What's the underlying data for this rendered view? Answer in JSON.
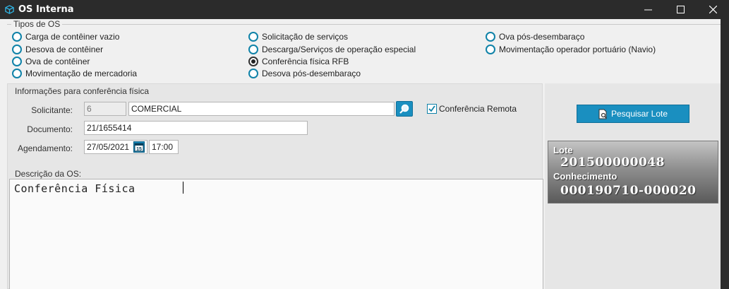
{
  "window": {
    "title": "OS Interna",
    "buttons": [
      "minimize",
      "maximize",
      "close"
    ]
  },
  "tipos_os": {
    "label": "Tipos de OS",
    "options": [
      {
        "label": "Carga de contêiner vazio",
        "selected": false
      },
      {
        "label": "Desova de contêiner",
        "selected": false
      },
      {
        "label": "Ova de contêiner",
        "selected": false
      },
      {
        "label": "Movimentação de mercadoria",
        "selected": false
      },
      {
        "label": "Solicitação de serviços",
        "selected": false
      },
      {
        "label": "Descarga/Serviços de operação especial",
        "selected": false
      },
      {
        "label": "Conferência física RFB",
        "selected": true
      },
      {
        "label": "Desova pós-desembaraço",
        "selected": false
      },
      {
        "label": "Ova pós-desembaraço",
        "selected": false
      },
      {
        "label": "Movimentação operador portuário (Navio)",
        "selected": false
      }
    ]
  },
  "info": {
    "title": "Informações para conferência física",
    "solicitante_label": "Solicitante:",
    "solicitante_code": "6",
    "solicitante_name": "COMERCIAL",
    "conferencia_remota_label": "Conferência Remota",
    "conferencia_remota_checked": true,
    "documento_label": "Documento:",
    "documento_value": "21/1655414",
    "agendamento_label": "Agendamento:",
    "agendamento_date": "27/05/2021",
    "agendamento_cal": "15",
    "agendamento_time": "17:00",
    "descricao_label": "Descrição da OS:",
    "descricao_value": "Conferência Física"
  },
  "right": {
    "pesquisar_lote_label": "Pesquisar Lote",
    "lote_caption": "Lote",
    "lote_value": "201500000048",
    "conhecimento_caption": "Conhecimento",
    "conhecimento_value": "000190710-000020"
  },
  "colors": {
    "accent": "#1a8fc0",
    "titlebar": "#2b2b2b"
  }
}
